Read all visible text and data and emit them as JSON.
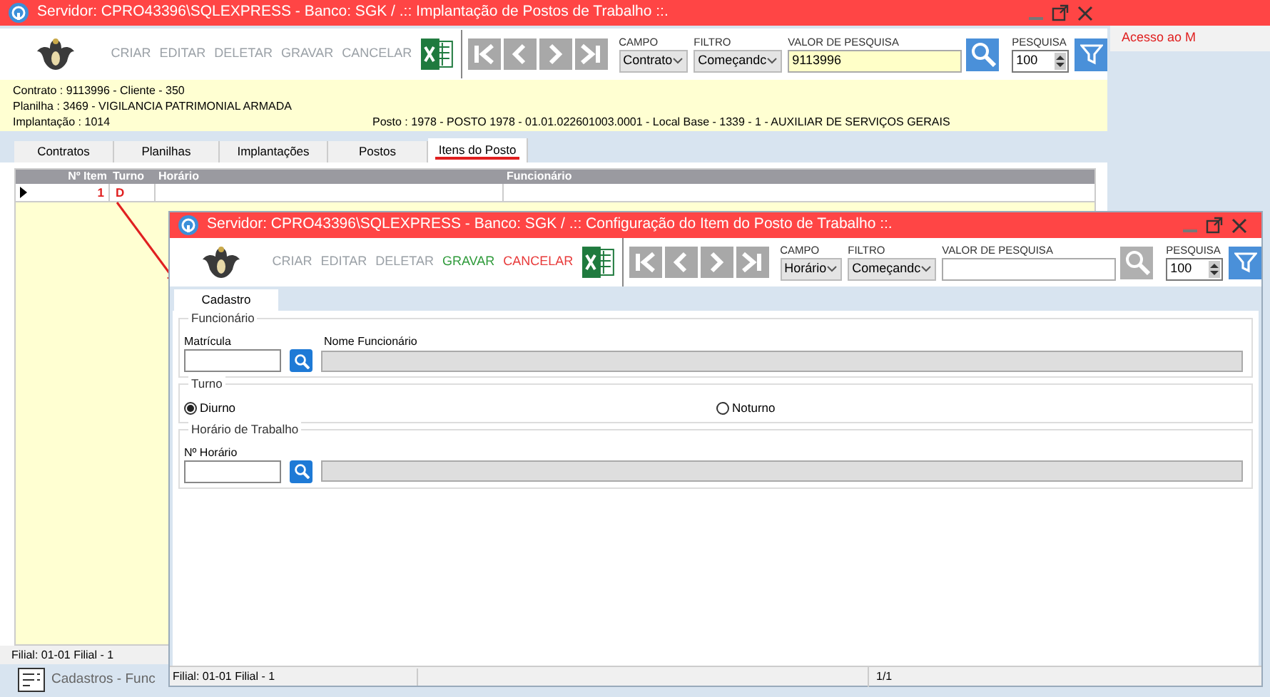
{
  "back_window": {
    "title": "Servidor: CPRO43396\\SQLEXPRESS - Banco: SGK / .:: Implantação de Postos de Trabalho ::.",
    "actions": [
      {
        "label": "CRIAR",
        "kind": "disabled"
      },
      {
        "label": "EDITAR",
        "kind": "disabled"
      },
      {
        "label": "DELETAR",
        "kind": "disabled"
      },
      {
        "label": "GRAVAR",
        "kind": "disabled"
      },
      {
        "label": "CANCELAR",
        "kind": "disabled"
      }
    ],
    "campo": {
      "label": "CAMPO",
      "value": "Contrato"
    },
    "filtro": {
      "label": "FILTRO",
      "value": "Começandc"
    },
    "search": {
      "label": "VALOR DE PESQUISA",
      "value": "9113996",
      "enabled": true
    },
    "limit": {
      "label": "PESQUISA",
      "value": "100"
    },
    "info": [
      "Contrato : 9113996 - Cliente - 350",
      "Planilha : 3469 - VIGILANCIA PATRIMONIAL ARMADA",
      "Implantação : 1014"
    ],
    "posto": "Posto : 1978 - POSTO 1978 - 01.01.022601003.0001 - Local Base - 1339 - 1 - AUXILIAR DE SERVIÇOS GERAIS",
    "tabs": [
      {
        "label": "Contratos",
        "selected": false
      },
      {
        "label": "Planilhas",
        "selected": false
      },
      {
        "label": "Implantações",
        "selected": false
      },
      {
        "label": "Postos",
        "selected": false
      },
      {
        "label": "Itens do Posto",
        "selected": true
      }
    ],
    "grid": {
      "columns": [
        "Nº Item",
        "Turno",
        "Horário",
        "Funcionário"
      ],
      "rows": [
        {
          "item": "1",
          "turno": "D",
          "current": true
        }
      ]
    },
    "status_bar": "Filial: 01-01 Filial - 1"
  },
  "side_link": "Acesso ao M",
  "taskbar_item": "Cadastros - Func",
  "front_window": {
    "title": "Servidor: CPRO43396\\SQLEXPRESS - Banco: SGK / .:: Configuração do Item do Posto de Trabalho ::.",
    "actions": [
      {
        "label": "CRIAR",
        "kind": "disabled"
      },
      {
        "label": "EDITAR",
        "kind": "disabled"
      },
      {
        "label": "DELETAR",
        "kind": "disabled"
      },
      {
        "label": "GRAVAR",
        "kind": "save"
      },
      {
        "label": "CANCELAR",
        "kind": "cancel"
      }
    ],
    "campo": {
      "label": "CAMPO",
      "value": "Horário"
    },
    "filtro": {
      "label": "FILTRO",
      "value": "Começandc"
    },
    "search": {
      "label": "VALOR DE PESQUISA",
      "enabled": false
    },
    "limit": {
      "label": "PESQUISA",
      "value": "100"
    },
    "tabs": [
      {
        "label": "Cadastro",
        "selected": true
      }
    ],
    "funcionario": {
      "legend": "Funcionário",
      "code_label": "Matrícula",
      "name_label": "Nome Funcionário"
    },
    "turno": {
      "legend": "Turno",
      "options": [
        {
          "label": "Diurno",
          "selected": true
        },
        {
          "label": "Noturno",
          "selected": false
        }
      ]
    },
    "horario": {
      "legend": "Horário de Trabalho",
      "code_label": "Nº Horário"
    },
    "status_bar": [
      "Filial: 01-01 Filial - 1",
      "1/1"
    ]
  }
}
